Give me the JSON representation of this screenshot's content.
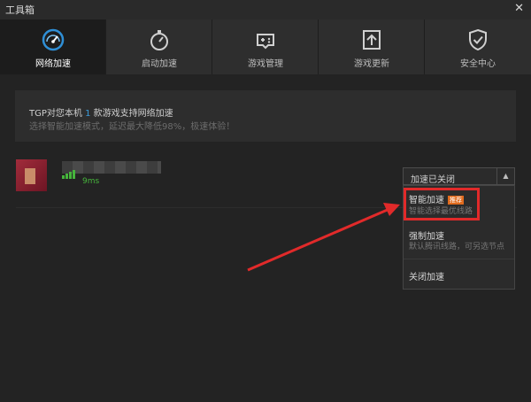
{
  "window": {
    "title": "工具箱",
    "close_glyph": "✕"
  },
  "tabs": [
    {
      "label": "网络加速",
      "icon": "speedometer-icon",
      "active": true
    },
    {
      "label": "启动加速",
      "icon": "stopwatch-icon"
    },
    {
      "label": "游戏管理",
      "icon": "gamepad-icon"
    },
    {
      "label": "游戏更新",
      "icon": "update-icon"
    },
    {
      "label": "安全中心",
      "icon": "shield-check-icon"
    }
  ],
  "info": {
    "line1_pre": "TGP对您本机",
    "count": "1",
    "line1_post": "款游戏支持网络加速",
    "line2": "选择智能加速模式，延迟最大降低98%，极速体验！"
  },
  "game": {
    "latency": "9ms",
    "signal_icon": "signal-bars-icon"
  },
  "dropdown": {
    "selected": "加速已关闭",
    "arrow_glyph": "▲",
    "options": [
      {
        "title": "智能加速",
        "badge": "推荐",
        "desc": "智能选择最优线路"
      },
      {
        "title": "强制加速",
        "desc": "默认腾讯线路，可另选节点"
      },
      {
        "title": "关闭加速"
      }
    ]
  },
  "colors": {
    "background": "#232323",
    "tab_active": "#1c1c1c",
    "accent_blue": "#3a9ad9",
    "signal_green": "#46b43c",
    "annotation_red": "#e12a2a",
    "badge_orange": "#e06b1e"
  }
}
